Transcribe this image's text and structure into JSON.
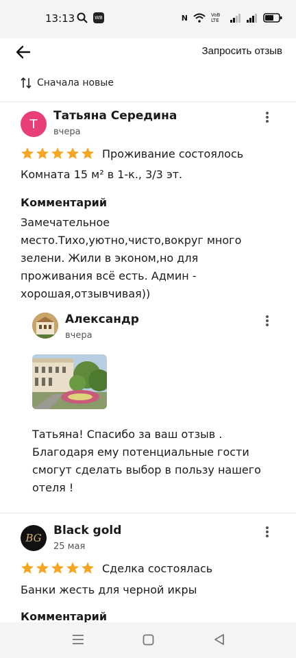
{
  "status_bar": {
    "time": "13:13",
    "wb_badge": "WB",
    "network": "VoB LTE"
  },
  "header": {
    "request_review": "Запросить отзыв"
  },
  "sort": {
    "label": "Сначала новые"
  },
  "reviews": [
    {
      "initial": "Т",
      "avatar_color": "#e83e7a",
      "author": "Татьяна Середина",
      "date": "вчера",
      "rating": 5,
      "status": "Проживание состоялось",
      "details": "Комната 15 м² в 1-к., 3/3 эт.",
      "comment_label": "Комментарий",
      "comment": "Замечательное\nместо.Тихо,уютно,чисто,вокруг много\nзелени. Жили в эконом,но для\nпроживания всё есть. Админ -\nхорошая,отзывчивая))",
      "reply": {
        "author": "Александр",
        "date": "вчера",
        "text": "Татьяна! Спасибо за ваш отзыв .\nБлагодаря ему потенциальные гости\nсмогут сделать выбор в пользу нашего\nотеля !"
      }
    },
    {
      "initial": "BG",
      "avatar_color": "#111111",
      "author": "Black gold",
      "date": "25 мая",
      "rating": 5,
      "status": "Сделка состоялась",
      "details": "Банки жесть для черной икры",
      "comment_label": "Комментарий"
    }
  ],
  "colors": {
    "star": "#f5a623",
    "accent_pink": "#e83e7a"
  }
}
